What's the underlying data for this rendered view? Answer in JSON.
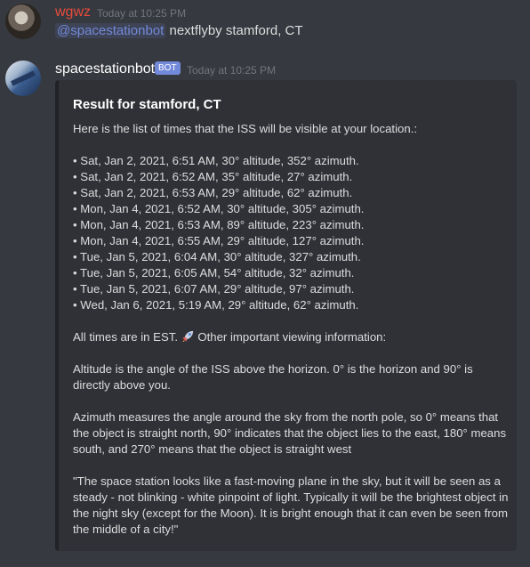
{
  "messages": [
    {
      "author": "wgwz",
      "timestamp": "Today at 10:25 PM",
      "mention": "@spacestationbot",
      "text": " nextflyby stamford, CT"
    },
    {
      "author": "spacestationbot",
      "badge": "BOT",
      "timestamp": "Today at 10:25 PM",
      "embed": {
        "title": "Result for stamford, CT",
        "intro": "Here is the list of times that the ISS will be visible at your location.:",
        "passes": [
          "• Sat, Jan 2, 2021, 6:51 AM, 30° altitude, 352° azimuth.",
          "• Sat, Jan 2, 2021, 6:52 AM, 35° altitude, 27° azimuth.",
          "• Sat, Jan 2, 2021, 6:53 AM, 29° altitude, 62° azimuth.",
          "• Mon, Jan 4, 2021, 6:52 AM, 30° altitude, 305° azimuth.",
          "• Mon, Jan 4, 2021, 6:53 AM, 89° altitude, 223° azimuth.",
          "• Mon, Jan 4, 2021, 6:55 AM, 29° altitude, 127° azimuth.",
          "• Tue, Jan 5, 2021, 6:04 AM, 30° altitude, 327° azimuth.",
          "• Tue, Jan 5, 2021, 6:05 AM, 54° altitude, 32° azimuth.",
          "• Tue, Jan 5, 2021, 6:07 AM, 29° altitude, 97° azimuth.",
          "• Wed, Jan 6, 2021, 5:19 AM, 29° altitude, 62° azimuth."
        ],
        "timezone_note": "All times are in EST.",
        "timezone_note_after": " Other important viewing information:",
        "altitude_info": "Altitude is the angle of the ISS above the horizon. 0° is the horizon and 90° is directly above you.",
        "azimuth_info": "Azimuth measures the angle around the sky from the north pole, so 0° means that the object is straight north, 90° indicates that the object lies to the east, 180° means south, and 270° means that the object is straight west",
        "quote": "\"The space station looks like a fast-moving plane in the sky, but it will be seen as a steady - not blinking - white pinpoint of light. Typically it will be the brightest object in the night sky (except for the Moon). It is bright enough that it can even be seen from the middle of a city!\""
      }
    }
  ],
  "colors": {
    "background": "#36393f",
    "embed_background": "#2f3136",
    "username_wgwz": "#e74c3c",
    "bot_badge": "#7289da",
    "mention": "#7289da"
  },
  "icons": [
    "rocket-icon"
  ]
}
